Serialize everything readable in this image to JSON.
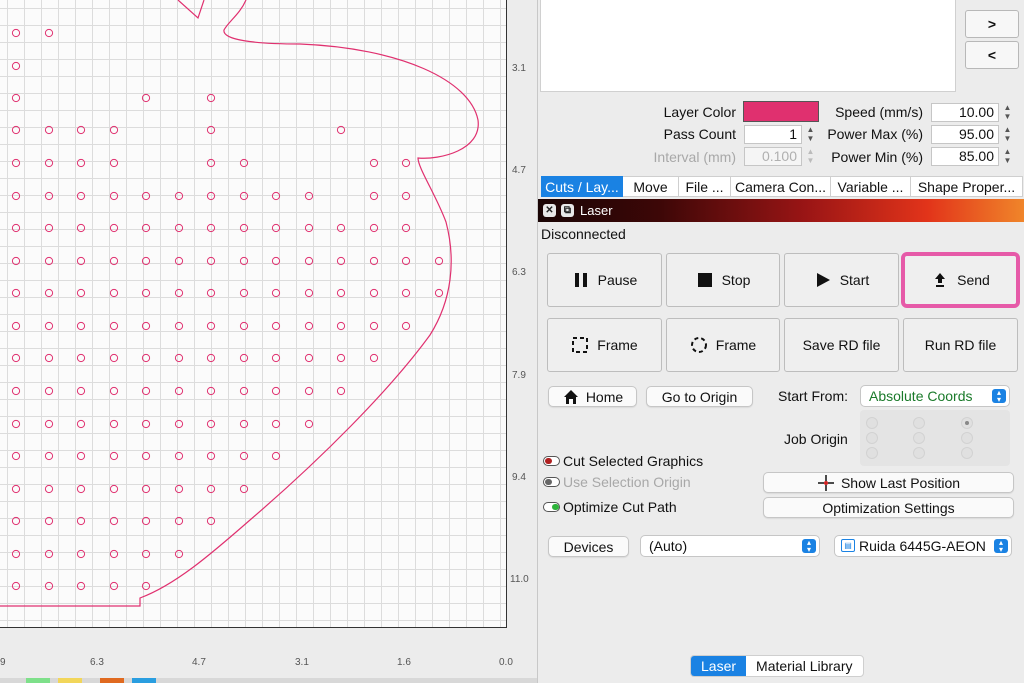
{
  "canvas": {
    "ruler_right": [
      "3.1",
      "4.7",
      "6.3",
      "7.9",
      "9.4",
      "11.0"
    ],
    "ruler_bottom": [
      "9",
      "6.3",
      "4.7",
      "3.1",
      "1.6",
      "0.0"
    ],
    "accent_color": "#e0306f"
  },
  "nav": {
    "next_label": ">",
    "prev_label": "<"
  },
  "layer_props": {
    "layer_color_label": "Layer Color",
    "layer_color_value": "#e0306f",
    "pass_count_label": "Pass Count",
    "pass_count_value": "1",
    "interval_label": "Interval (mm)",
    "interval_value": "0.100",
    "speed_label": "Speed (mm/s)",
    "speed_value": "10.00",
    "power_max_label": "Power Max (%)",
    "power_max_value": "95.00",
    "power_min_label": "Power Min (%)",
    "power_min_value": "85.00"
  },
  "tabs": [
    "Cuts / Lay...",
    "Move",
    "File ...",
    "Camera Con...",
    "Variable ...",
    "Shape Proper..."
  ],
  "laser": {
    "title": "Laser",
    "status": "Disconnected",
    "buttons_row1": [
      "Pause",
      "Stop",
      "Start",
      "Send"
    ],
    "buttons_row2": [
      "Frame",
      "Frame",
      "Save RD file",
      "Run RD file"
    ],
    "home_label": "Home",
    "go_origin_label": "Go to Origin",
    "start_from_label": "Start From:",
    "start_from_value": "Absolute Coords",
    "job_origin_label": "Job Origin",
    "cut_selected_label": "Cut Selected Graphics",
    "use_selection_origin_label": "Use Selection Origin",
    "optimize_cut_path_label": "Optimize Cut Path",
    "show_last_position_label": "Show Last Position",
    "optimization_settings_label": "Optimization Settings",
    "devices_label": "Devices",
    "port_value": "(Auto)",
    "device_value": "Ruida 6445G-AEON"
  },
  "bottom_tabs": [
    "Laser",
    "Material Library"
  ],
  "icons": {
    "pause": "pause-icon",
    "stop": "stop-icon",
    "start": "play-icon",
    "send": "upload-arrow-icon",
    "frame_rect": "rect-frame-icon",
    "frame_circle": "circle-frame-icon",
    "home": "home-icon",
    "crosshair": "crosshair-icon",
    "device": "device-icon"
  }
}
